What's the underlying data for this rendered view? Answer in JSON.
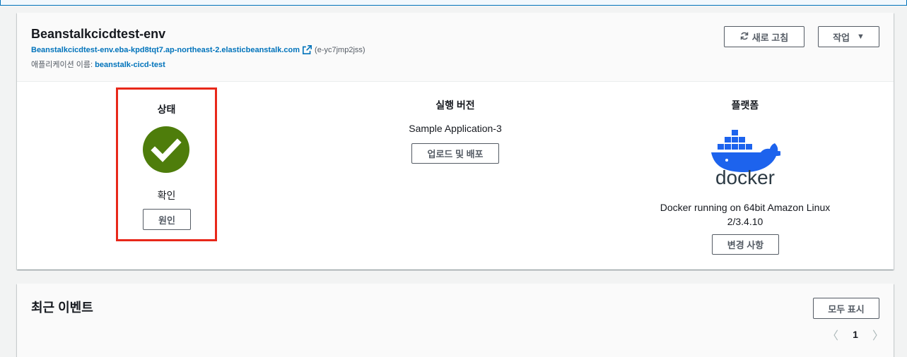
{
  "environment": {
    "name": "Beanstalkcicdtest-env",
    "url": "Beanstalkcicdtest-env.eba-kpd8tqt7.ap-northeast-2.elasticbeanstalk.com",
    "env_id": "(e-yc7jmp2jss)",
    "app_label": "애플리케이션 이름:",
    "app_name": "beanstalk-cicd-test"
  },
  "header_buttons": {
    "refresh_label": "새로 고침",
    "actions_label": "작업"
  },
  "status": {
    "title": "상태",
    "value": "확인",
    "cause_button": "원인",
    "color": "#4e7d0b"
  },
  "version": {
    "title": "실행 버전",
    "value": "Sample Application-3",
    "deploy_button": "업로드 및 배포"
  },
  "platform": {
    "title": "플랫폼",
    "logo_text": "docker",
    "description": "Docker running on 64bit Amazon Linux 2/3.4.10",
    "change_button": "변경 사항"
  },
  "events": {
    "title": "최근 이벤트",
    "show_all_button": "모두 표시",
    "page": "1"
  },
  "colors": {
    "link": "#0073bb",
    "highlight": "#e8281a",
    "docker_blue": "#1d63ed"
  }
}
